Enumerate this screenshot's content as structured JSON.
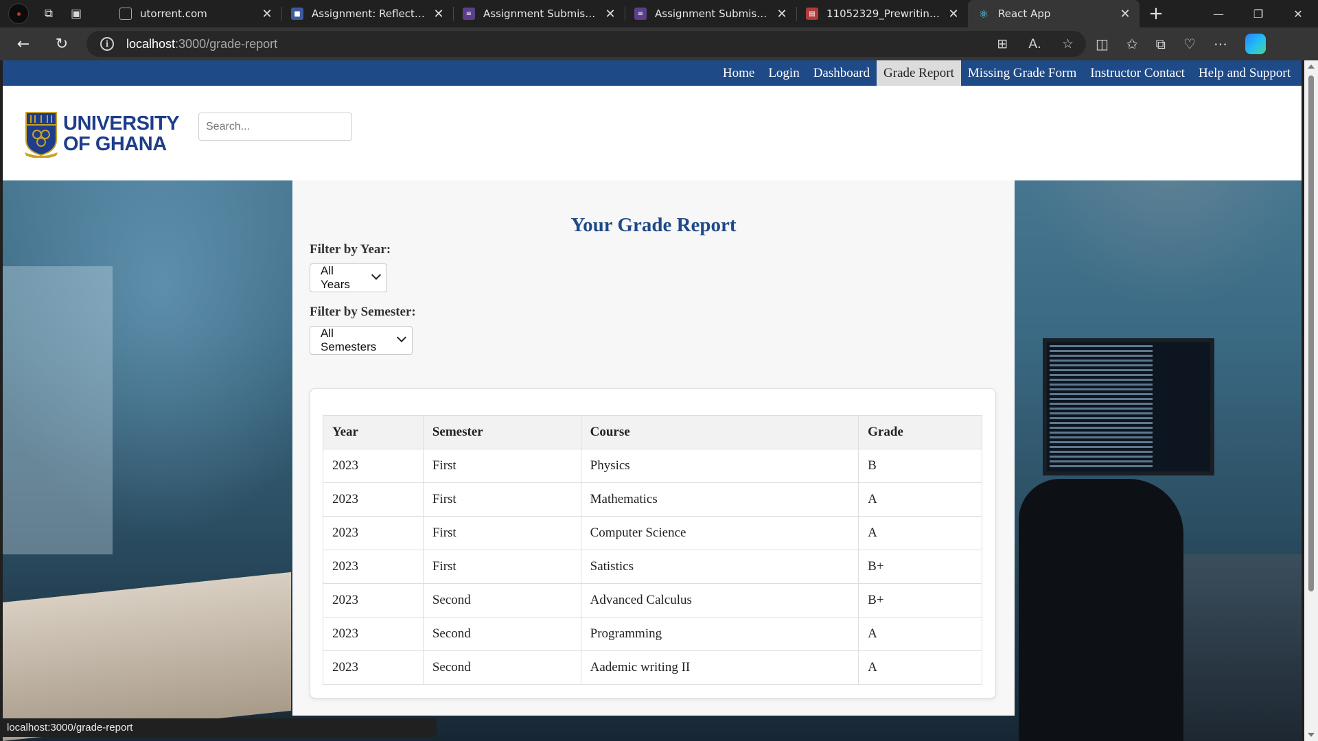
{
  "browser": {
    "tabs": [
      {
        "title": "utorrent.com",
        "favicon": "page-icon"
      },
      {
        "title": "Assignment: Reflecting on",
        "favicon": "canvas-icon"
      },
      {
        "title": "Assignment Submission:",
        "favicon": "list-icon"
      },
      {
        "title": "Assignment Submission:",
        "favicon": "list-icon"
      },
      {
        "title": "11052329_Prewriting Acti",
        "favicon": "pdf-icon"
      },
      {
        "title": "React App",
        "favicon": "react-icon"
      }
    ],
    "address": {
      "host": "localhost",
      "path": ":3000/grade-report"
    },
    "status_text": "localhost:3000/grade-report"
  },
  "nav": {
    "items": [
      "Home",
      "Login",
      "Dashboard",
      "Grade Report",
      "Missing Grade Form",
      "Instructor Contact",
      "Help and Support"
    ],
    "active": "Grade Report"
  },
  "header": {
    "logo_line1": "UNIVERSITY",
    "logo_line2": "OF GHANA",
    "search_placeholder": "Search..."
  },
  "report": {
    "title": "Your Grade Report",
    "year_filter_label": "Filter by Year:",
    "year_filter_value": "All Years",
    "semester_filter_label": "Filter by Semester:",
    "semester_filter_value": "All Semesters",
    "columns": [
      "Year",
      "Semester",
      "Course",
      "Grade"
    ],
    "rows": [
      [
        "2023",
        "First",
        "Physics",
        "B"
      ],
      [
        "2023",
        "First",
        "Mathematics",
        "A"
      ],
      [
        "2023",
        "First",
        "Computer Science",
        "A"
      ],
      [
        "2023",
        "First",
        "Satistics",
        "B+"
      ],
      [
        "2023",
        "Second",
        "Advanced Calculus",
        "B+"
      ],
      [
        "2023",
        "Second",
        "Programming",
        "A"
      ],
      [
        "2023",
        "Second",
        "Aademic writing II",
        "A"
      ]
    ]
  },
  "colors": {
    "nav_bg": "#1e4a87",
    "title_color": "#1e4a87",
    "logo_text": "#1e3d8a"
  }
}
